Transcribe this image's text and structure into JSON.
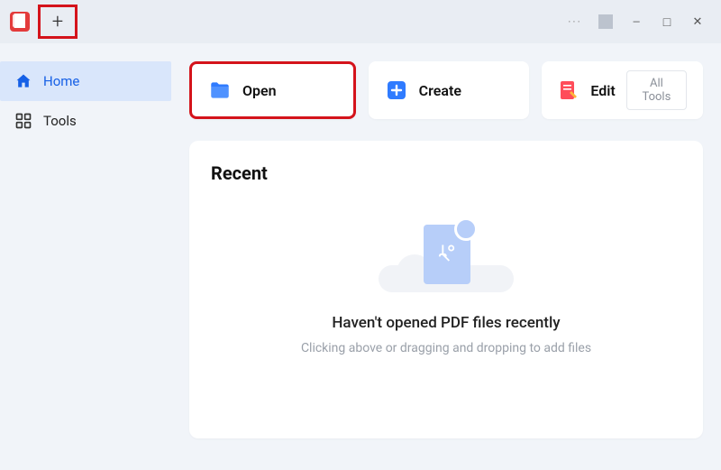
{
  "titlebar": {
    "new_tab_symbol": "+",
    "more_symbol": "···",
    "minimize_symbol": "—",
    "maximize_symbol": "□",
    "close_symbol": "✕"
  },
  "sidebar": {
    "items": [
      {
        "label": "Home",
        "icon": "home-icon",
        "active": true
      },
      {
        "label": "Tools",
        "icon": "tools-icon",
        "active": false
      }
    ]
  },
  "actions": {
    "open_label": "Open",
    "create_label": "Create",
    "edit_label": "Edit",
    "all_tools_label": "All Tools"
  },
  "recent": {
    "title": "Recent",
    "empty_headline": "Haven't opened PDF files recently",
    "empty_sub": "Clicking above or dragging and dropping to add files"
  }
}
